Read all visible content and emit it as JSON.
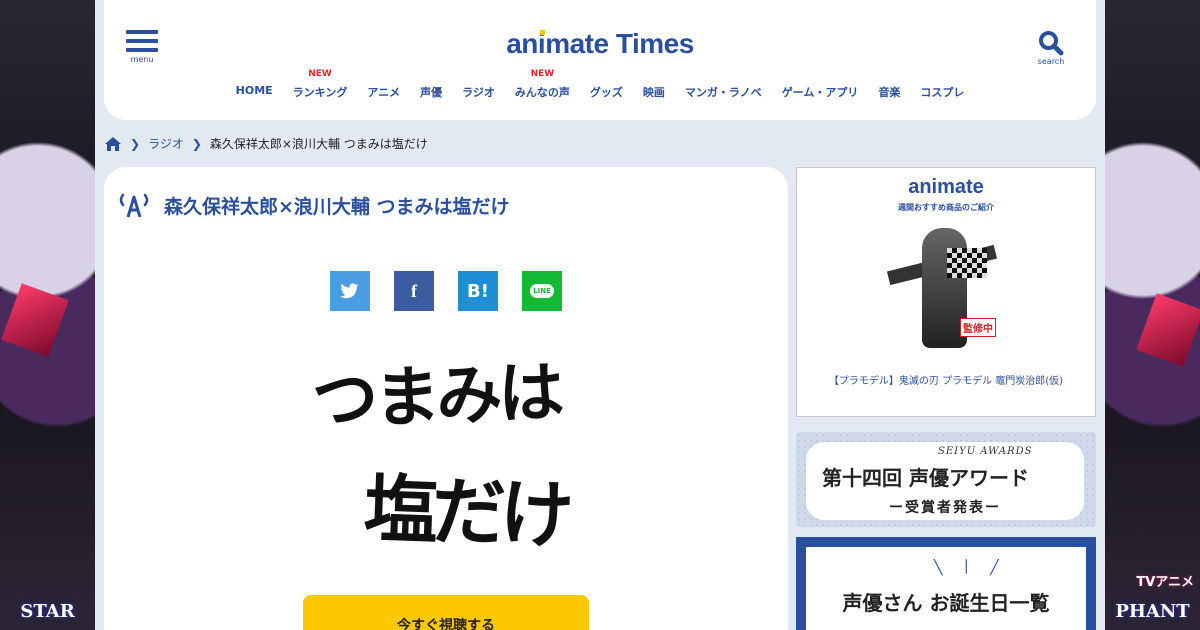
{
  "header": {
    "menu_label": "menu",
    "logo": {
      "pre": "an",
      "i": "i",
      "post": "mate Times"
    },
    "search_label": "search"
  },
  "nav": [
    {
      "label": "HOME",
      "badge": ""
    },
    {
      "label": "ランキング",
      "badge": "NEW"
    },
    {
      "label": "アニメ",
      "badge": ""
    },
    {
      "label": "声優",
      "badge": ""
    },
    {
      "label": "ラジオ",
      "badge": ""
    },
    {
      "label": "みんなの声",
      "badge": "NEW"
    },
    {
      "label": "グッズ",
      "badge": ""
    },
    {
      "label": "映画",
      "badge": ""
    },
    {
      "label": "マンガ・ラノベ",
      "badge": ""
    },
    {
      "label": "ゲーム・アプリ",
      "badge": ""
    },
    {
      "label": "音楽",
      "badge": ""
    },
    {
      "label": "コスプレ",
      "badge": ""
    }
  ],
  "breadcrumb": {
    "category": "ラジオ",
    "current": "森久保祥太郎×浪川大輔 つまみは塩だけ"
  },
  "article": {
    "title": "森久保祥太郎×浪川大輔 つまみは塩だけ",
    "share": {
      "hatena": "B!",
      "line": "LINE"
    },
    "calligraphy": {
      "line1": "つまみは",
      "line2": "塩だけ"
    },
    "listen_button": "今すぐ視聴する"
  },
  "sidebar": {
    "ad": {
      "logo": "animate",
      "sub": "週間おすすめ商品のご紹介",
      "stamp": "監修中",
      "caption": "【プラモデル】鬼滅の刃 プラモデル 竈門炭治郎(仮)"
    },
    "award": {
      "seiyu_awards": "SEIYU AWARDS",
      "title": "第十四回 声優アワード",
      "sub": "ー受賞者発表ー"
    },
    "birthday": {
      "title": "声優さん お誕生日一覧"
    }
  },
  "side_banners": {
    "left_text": "STAR",
    "right_text": "PHANT",
    "right_tv": "TVアニメ"
  },
  "colors": {
    "brand": "#2a4f9c",
    "accent_yellow": "#fcc800",
    "new_badge": "#e0262e",
    "page_bg": "#e3e9f3"
  }
}
